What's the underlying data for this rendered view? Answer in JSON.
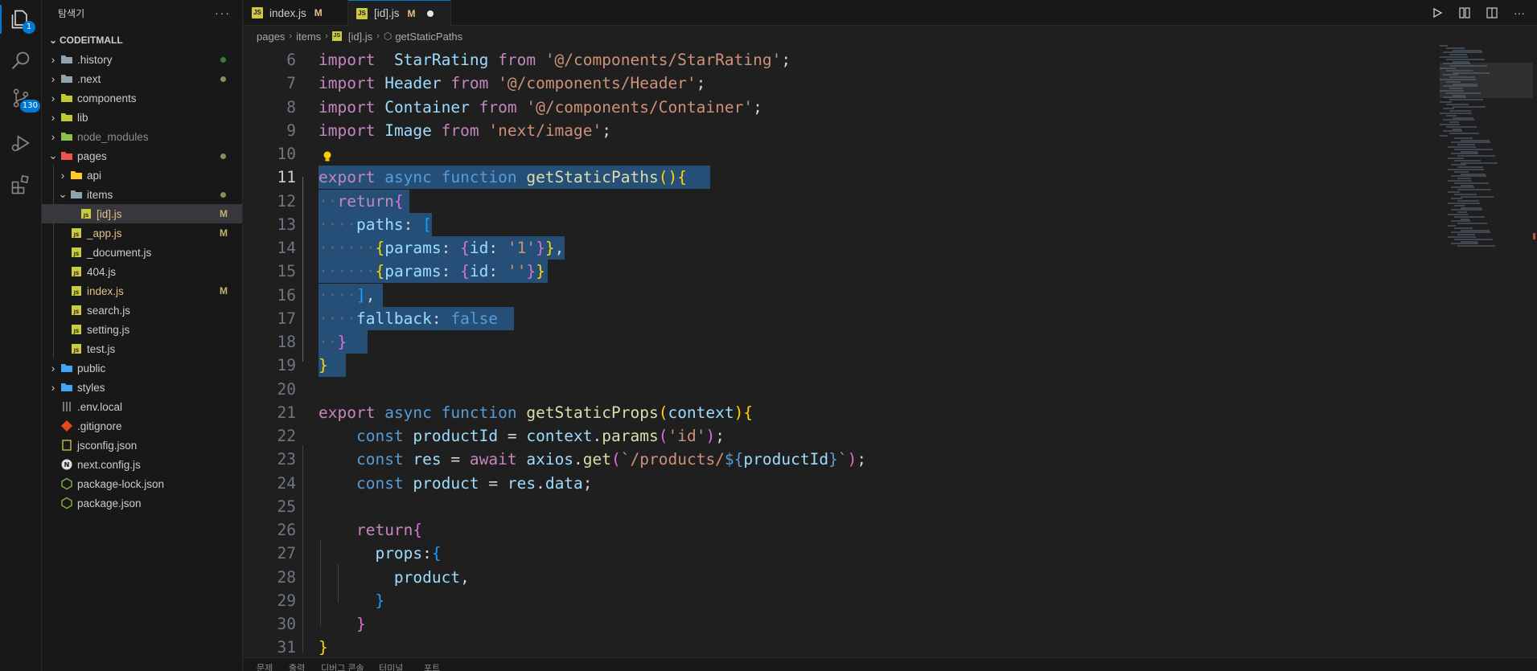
{
  "activity_bar": {
    "items": [
      {
        "name": "explorer-icon",
        "badge": "1"
      },
      {
        "name": "search-icon",
        "badge": ""
      },
      {
        "name": "source-control-icon",
        "badge": "130"
      },
      {
        "name": "run-debug-icon",
        "badge": ""
      },
      {
        "name": "extensions-icon",
        "badge": ""
      }
    ]
  },
  "sidebar": {
    "title": "탐색기",
    "more": "···",
    "root": "CODEITMALL",
    "tree": [
      {
        "label": ".history",
        "depth": 0,
        "type": "folder",
        "expanded": false,
        "status": "dot-green"
      },
      {
        "label": ".next",
        "depth": 0,
        "type": "folder",
        "expanded": false,
        "status": "dot"
      },
      {
        "label": "components",
        "depth": 0,
        "type": "folder",
        "expanded": false,
        "status": ""
      },
      {
        "label": "lib",
        "depth": 0,
        "type": "folder",
        "expanded": false,
        "status": ""
      },
      {
        "label": "node_modules",
        "depth": 0,
        "type": "folder",
        "expanded": false,
        "status": ""
      },
      {
        "label": "pages",
        "depth": 0,
        "type": "folder",
        "expanded": true,
        "status": "dot"
      },
      {
        "label": "api",
        "depth": 1,
        "type": "folder",
        "expanded": false,
        "status": ""
      },
      {
        "label": "items",
        "depth": 1,
        "type": "folder",
        "expanded": true,
        "status": "dot"
      },
      {
        "label": "[id].js",
        "depth": 2,
        "type": "js",
        "status": "M",
        "selected": true
      },
      {
        "label": "_app.js",
        "depth": 1,
        "type": "js",
        "status": "M"
      },
      {
        "label": "_document.js",
        "depth": 1,
        "type": "js",
        "status": ""
      },
      {
        "label": "404.js",
        "depth": 1,
        "type": "js",
        "status": ""
      },
      {
        "label": "index.js",
        "depth": 1,
        "type": "js",
        "status": "M"
      },
      {
        "label": "search.js",
        "depth": 1,
        "type": "js",
        "status": ""
      },
      {
        "label": "setting.js",
        "depth": 1,
        "type": "js",
        "status": ""
      },
      {
        "label": "test.js",
        "depth": 1,
        "type": "js",
        "status": ""
      },
      {
        "label": "public",
        "depth": 0,
        "type": "folder",
        "expanded": false,
        "status": ""
      },
      {
        "label": "styles",
        "depth": 0,
        "type": "folder",
        "expanded": false,
        "status": ""
      },
      {
        "label": ".env.local",
        "depth": 0,
        "type": "env",
        "status": ""
      },
      {
        "label": ".gitignore",
        "depth": 0,
        "type": "git",
        "status": ""
      },
      {
        "label": "jsconfig.json",
        "depth": 0,
        "type": "json",
        "status": ""
      },
      {
        "label": "next.config.js",
        "depth": 0,
        "type": "next",
        "status": ""
      },
      {
        "label": "package-lock.json",
        "depth": 0,
        "type": "npm",
        "status": ""
      },
      {
        "label": "package.json",
        "depth": 0,
        "type": "npm",
        "status": ""
      }
    ]
  },
  "tabs": [
    {
      "label": "index.js",
      "status": "M",
      "active": false
    },
    {
      "label": "[id].js",
      "status": "M",
      "active": true,
      "dirty": true
    }
  ],
  "breadcrumb": {
    "parts": [
      "pages",
      "items",
      "[id].js",
      "getStaticPaths"
    ]
  },
  "editor": {
    "lines": [
      {
        "n": "6",
        "tokens": [
          [
            "kw",
            "import"
          ],
          [
            "",
            "  "
          ],
          [
            "id",
            "StarRating"
          ],
          [
            "",
            " "
          ],
          [
            "kw",
            "from"
          ],
          [
            "",
            " "
          ],
          [
            "str",
            "'@/components/StarRating'"
          ],
          [
            "",
            ";"
          ]
        ]
      },
      {
        "n": "7",
        "tokens": [
          [
            "kw",
            "import"
          ],
          [
            "",
            " "
          ],
          [
            "id",
            "Header"
          ],
          [
            "",
            " "
          ],
          [
            "kw",
            "from"
          ],
          [
            "",
            " "
          ],
          [
            "str",
            "'@/components/Header'"
          ],
          [
            "",
            ";"
          ]
        ]
      },
      {
        "n": "8",
        "tokens": [
          [
            "kw",
            "import"
          ],
          [
            "",
            " "
          ],
          [
            "id",
            "Container"
          ],
          [
            "",
            " "
          ],
          [
            "kw",
            "from"
          ],
          [
            "",
            " "
          ],
          [
            "str",
            "'@/components/Container'"
          ],
          [
            "",
            ";"
          ]
        ]
      },
      {
        "n": "9",
        "tokens": [
          [
            "kw",
            "import"
          ],
          [
            "",
            " "
          ],
          [
            "id",
            "Image"
          ],
          [
            "",
            " "
          ],
          [
            "kw",
            "from"
          ],
          [
            "",
            " "
          ],
          [
            "str",
            "'next/image'"
          ],
          [
            "",
            ";"
          ]
        ]
      },
      {
        "n": "10",
        "tokens": []
      },
      {
        "n": "11",
        "tokens": [
          [
            "kw",
            "export"
          ],
          [
            "",
            " "
          ],
          [
            "st",
            "async"
          ],
          [
            "",
            " "
          ],
          [
            "st",
            "function"
          ],
          [
            "",
            " "
          ],
          [
            "fn",
            "getStaticPaths"
          ],
          [
            "b1",
            "()"
          ],
          [
            "b1",
            "{"
          ]
        ]
      },
      {
        "n": "12",
        "tokens": [
          [
            "ws",
            "··"
          ],
          [
            "kw",
            "return"
          ],
          [
            "b2",
            "{"
          ]
        ]
      },
      {
        "n": "13",
        "tokens": [
          [
            "ws",
            "····"
          ],
          [
            "id",
            "paths"
          ],
          [
            "",
            ": "
          ],
          [
            "b3",
            "["
          ]
        ]
      },
      {
        "n": "14",
        "tokens": [
          [
            "ws",
            "······"
          ],
          [
            "b1",
            "{"
          ],
          [
            "id",
            "params"
          ],
          [
            "",
            ": "
          ],
          [
            "b2",
            "{"
          ],
          [
            "id",
            "id"
          ],
          [
            "",
            ": "
          ],
          [
            "str",
            "'1'"
          ],
          [
            "b2",
            "}"
          ],
          [
            "b1",
            "}"
          ],
          [
            "",
            ","
          ]
        ]
      },
      {
        "n": "15",
        "tokens": [
          [
            "ws",
            "······"
          ],
          [
            "b1",
            "{"
          ],
          [
            "id",
            "params"
          ],
          [
            "",
            ": "
          ],
          [
            "b2",
            "{"
          ],
          [
            "id",
            "id"
          ],
          [
            "",
            ": "
          ],
          [
            "str",
            "''"
          ],
          [
            "b2",
            "}"
          ],
          [
            "b1",
            "}"
          ]
        ]
      },
      {
        "n": "16",
        "tokens": [
          [
            "ws",
            "····"
          ],
          [
            "b3",
            "]"
          ],
          [
            "",
            ","
          ]
        ]
      },
      {
        "n": "17",
        "tokens": [
          [
            "ws",
            "····"
          ],
          [
            "id",
            "fallback"
          ],
          [
            "",
            ": "
          ],
          [
            "st",
            "false"
          ]
        ]
      },
      {
        "n": "18",
        "tokens": [
          [
            "ws",
            "··"
          ],
          [
            "b2",
            "}"
          ]
        ]
      },
      {
        "n": "19",
        "tokens": [
          [
            "b1",
            "}"
          ]
        ]
      },
      {
        "n": "20",
        "tokens": []
      },
      {
        "n": "21",
        "tokens": [
          [
            "kw",
            "export"
          ],
          [
            "",
            " "
          ],
          [
            "st",
            "async"
          ],
          [
            "",
            " "
          ],
          [
            "st",
            "function"
          ],
          [
            "",
            " "
          ],
          [
            "fn",
            "getStaticProps"
          ],
          [
            "b1",
            "("
          ],
          [
            "id",
            "context"
          ],
          [
            "b1",
            ")"
          ],
          [
            "b1",
            "{"
          ]
        ]
      },
      {
        "n": "22",
        "tokens": [
          [
            "",
            "    "
          ],
          [
            "st",
            "const"
          ],
          [
            "",
            " "
          ],
          [
            "id",
            "productId"
          ],
          [
            "",
            " = "
          ],
          [
            "id",
            "context"
          ],
          [
            "",
            "."
          ],
          [
            "fn",
            "params"
          ],
          [
            "b2",
            "("
          ],
          [
            "str",
            "'id'"
          ],
          [
            "b2",
            ")"
          ],
          [
            "",
            ";"
          ]
        ]
      },
      {
        "n": "23",
        "tokens": [
          [
            "",
            "    "
          ],
          [
            "st",
            "const"
          ],
          [
            "",
            " "
          ],
          [
            "id",
            "res"
          ],
          [
            "",
            " = "
          ],
          [
            "kw",
            "await"
          ],
          [
            "",
            " "
          ],
          [
            "id",
            "axios"
          ],
          [
            "",
            "."
          ],
          [
            "fn",
            "get"
          ],
          [
            "b2",
            "("
          ],
          [
            "str",
            "`/products/"
          ],
          [
            "st",
            "${"
          ],
          [
            "id",
            "productId"
          ],
          [
            "st",
            "}"
          ],
          [
            "str",
            "`"
          ],
          [
            "b2",
            ")"
          ],
          [
            "",
            ";"
          ]
        ]
      },
      {
        "n": "24",
        "tokens": [
          [
            "",
            "    "
          ],
          [
            "st",
            "const"
          ],
          [
            "",
            " "
          ],
          [
            "id",
            "product"
          ],
          [
            "",
            " = "
          ],
          [
            "id",
            "res"
          ],
          [
            "",
            "."
          ],
          [
            "id",
            "data"
          ],
          [
            "",
            ";"
          ]
        ]
      },
      {
        "n": "25",
        "tokens": []
      },
      {
        "n": "26",
        "tokens": [
          [
            "",
            "    "
          ],
          [
            "kw",
            "return"
          ],
          [
            "b2",
            "{"
          ]
        ]
      },
      {
        "n": "27",
        "tokens": [
          [
            "",
            "      "
          ],
          [
            "id",
            "props"
          ],
          [
            "",
            ":"
          ],
          [
            "b3",
            "{"
          ]
        ]
      },
      {
        "n": "28",
        "tokens": [
          [
            "",
            "        "
          ],
          [
            "id",
            "product"
          ],
          [
            "",
            ","
          ]
        ]
      },
      {
        "n": "29",
        "tokens": [
          [
            "",
            "      "
          ],
          [
            "b3",
            "}"
          ]
        ]
      },
      {
        "n": "30",
        "tokens": [
          [
            "",
            "    "
          ],
          [
            "b2",
            "}"
          ]
        ]
      },
      {
        "n": "31",
        "tokens": [
          [
            "b1",
            "}"
          ]
        ]
      }
    ]
  },
  "panel": {
    "tabs": [
      "문제",
      "출력",
      "디버그 콘솔",
      "터미널",
      "포트"
    ]
  },
  "colors": {
    "accent": "#0078d4",
    "selection": "#264f78",
    "modified": "#e2c08d"
  }
}
